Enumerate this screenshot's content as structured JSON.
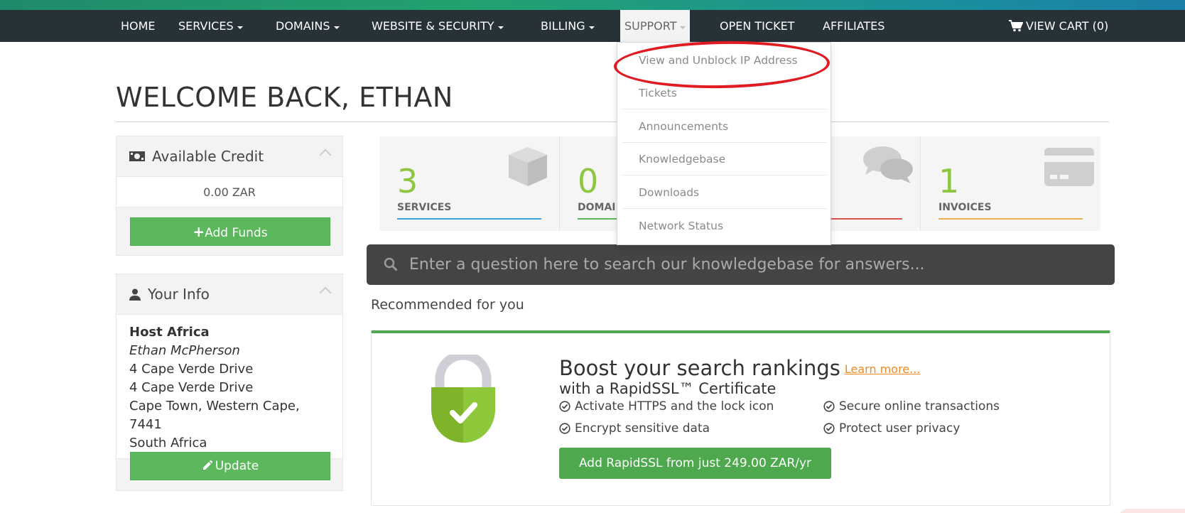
{
  "nav": {
    "home": "HOME",
    "services": "SERVICES",
    "domains": "DOMAINS",
    "website_security": "WEBSITE & SECURITY",
    "billing": "BILLING",
    "support": "SUPPORT",
    "open_ticket": "OPEN TICKET",
    "affiliates": "AFFILIATES",
    "view_cart": "VIEW CART (0)"
  },
  "support_dropdown": {
    "items": [
      "View and Unblock IP Address",
      "Tickets",
      "Announcements",
      "Knowledgebase",
      "Downloads",
      "Network Status"
    ],
    "highlighted_item_color": "#e11b22"
  },
  "page_title": "WELCOME BACK, ETHAN",
  "credit_panel": {
    "title": "Available Credit",
    "amount": "0.00 ZAR",
    "button": "Add Funds"
  },
  "info_panel": {
    "title": "Your Info",
    "company": "Host Africa",
    "name": "Ethan McPherson",
    "address1": "4 Cape Verde Drive",
    "address2": "4 Cape Verde Drive",
    "city_line": "Cape Town, Western Cape, 7441",
    "country": "South Africa",
    "button": "Update"
  },
  "stats": [
    {
      "count": "3",
      "label": "SERVICES",
      "color": "#39a6d6",
      "icon": "cube-icon"
    },
    {
      "count": "0",
      "label": "DOMAI",
      "color": "#5cb85c",
      "icon": "globe-icon"
    },
    {
      "count": "",
      "label": "",
      "color": "#d9534f",
      "icon": "chat-icon"
    },
    {
      "count": "1",
      "label": "INVOICES",
      "color": "#f0ad4e",
      "icon": "credit-card-icon"
    }
  ],
  "kb_search": {
    "placeholder": "Enter a question here to search our knowledgebase for answers..."
  },
  "recommended": {
    "title": "Recommended for you",
    "headline": "Boost your search rankings",
    "learn_more": "Learn more...",
    "subheadline": "with a RapidSSL™ Certificate",
    "features": [
      "Activate HTTPS and the lock icon",
      "Secure online transactions",
      "Encrypt sensitive data",
      "Protect user privacy"
    ],
    "cta": "Add RapidSSL from just 249.00 ZAR/yr"
  },
  "colors": {
    "navbar": "#263238",
    "green": "#5cb85c",
    "accent_number": "#8ec641",
    "link_orange": "#f08a24"
  }
}
